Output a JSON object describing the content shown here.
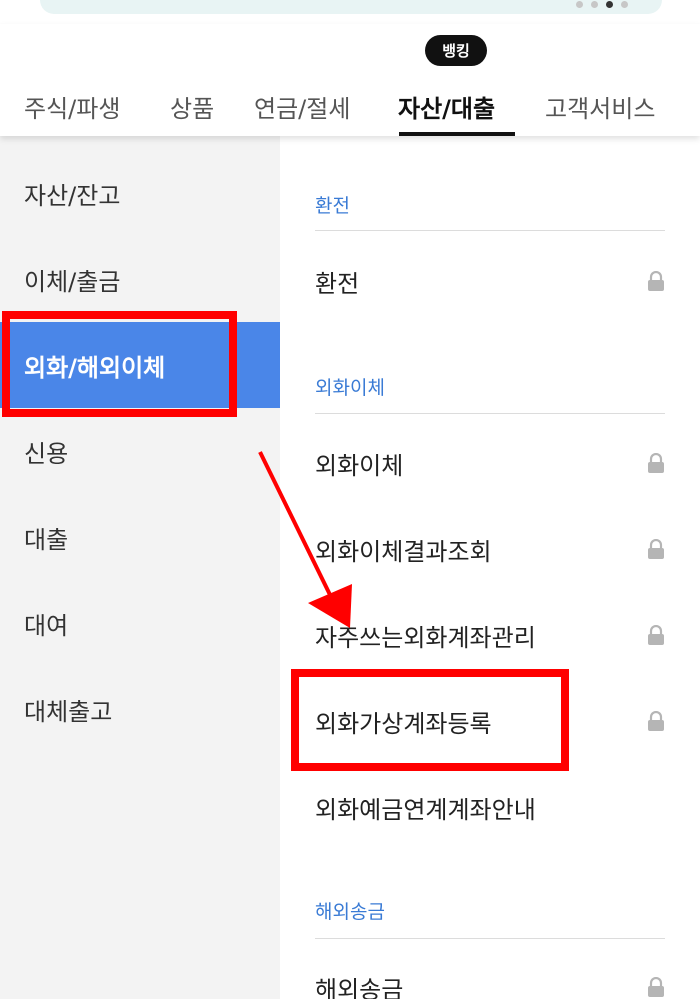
{
  "tabs": [
    {
      "label": "주식/파생",
      "active": false
    },
    {
      "label": "상품",
      "active": false
    },
    {
      "label": "연금/절세",
      "active": false
    },
    {
      "label": "자산/대출",
      "active": true
    },
    {
      "label": "고객서비스",
      "active": false
    }
  ],
  "badge": "뱅킹",
  "carousel": {
    "pages": 4,
    "active_index": 2
  },
  "sidebar": {
    "items": [
      {
        "label": "자산/잔고",
        "active": false
      },
      {
        "label": "이체/출금",
        "active": false
      },
      {
        "label": "외화/해외이체",
        "active": true
      },
      {
        "label": "신용",
        "active": false
      },
      {
        "label": "대출",
        "active": false
      },
      {
        "label": "대여",
        "active": false
      },
      {
        "label": "대체출고",
        "active": false
      }
    ]
  },
  "content": {
    "sections": [
      {
        "title": "환전",
        "items": [
          {
            "label": "환전",
            "locked": true
          }
        ]
      },
      {
        "title": "외화이체",
        "items": [
          {
            "label": "외화이체",
            "locked": true
          },
          {
            "label": "외화이체결과조회",
            "locked": true
          },
          {
            "label": "자주쓰는외화계좌관리",
            "locked": true
          },
          {
            "label": "외화가상계좌등록",
            "locked": true
          },
          {
            "label": "외화예금연계계좌안내",
            "locked": false
          }
        ]
      },
      {
        "title": "해외송금",
        "items": [
          {
            "label": "해외송금",
            "locked": true
          }
        ]
      }
    ]
  },
  "colors": {
    "accent": "#4a86e8",
    "section_label": "#3a7bd5",
    "highlight": "#ff0000"
  }
}
